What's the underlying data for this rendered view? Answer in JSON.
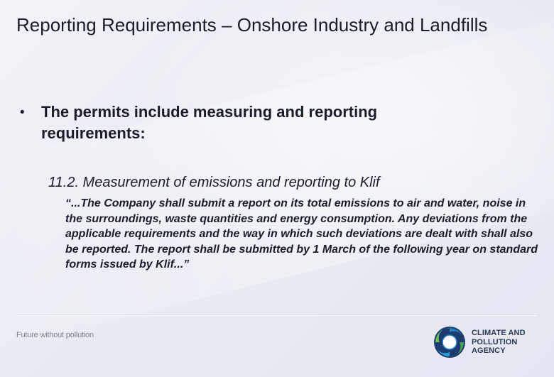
{
  "slide": {
    "title": "Reporting Requirements – Onshore Industry and Landfills",
    "bullet": {
      "marker": "•",
      "text": "The permits include measuring and reporting requirements:"
    },
    "sub_heading": "11.2. Measurement of emissions and reporting to Klif",
    "quote": "“...The Company shall submit a report on its total emissions to air and water, noise in the surroundings, waste quantities and energy consumption. Any deviations from the applicable requirements and the way in which such deviations are dealt with shall also be reported. The report shall be submitted by 1 March of the following year on standard forms issued by Klif...”"
  },
  "footer": {
    "tagline": "Future without pollution",
    "logo": {
      "icon": "globe-swirl-logo-icon",
      "lines": [
        "CLIMATE AND",
        "POLLUTION",
        "AGENCY"
      ],
      "colors": {
        "dark_blue": "#1c3b6e",
        "mid_blue": "#1f7fc0",
        "green": "#4aa04a",
        "text": "#2b3a55"
      }
    }
  }
}
